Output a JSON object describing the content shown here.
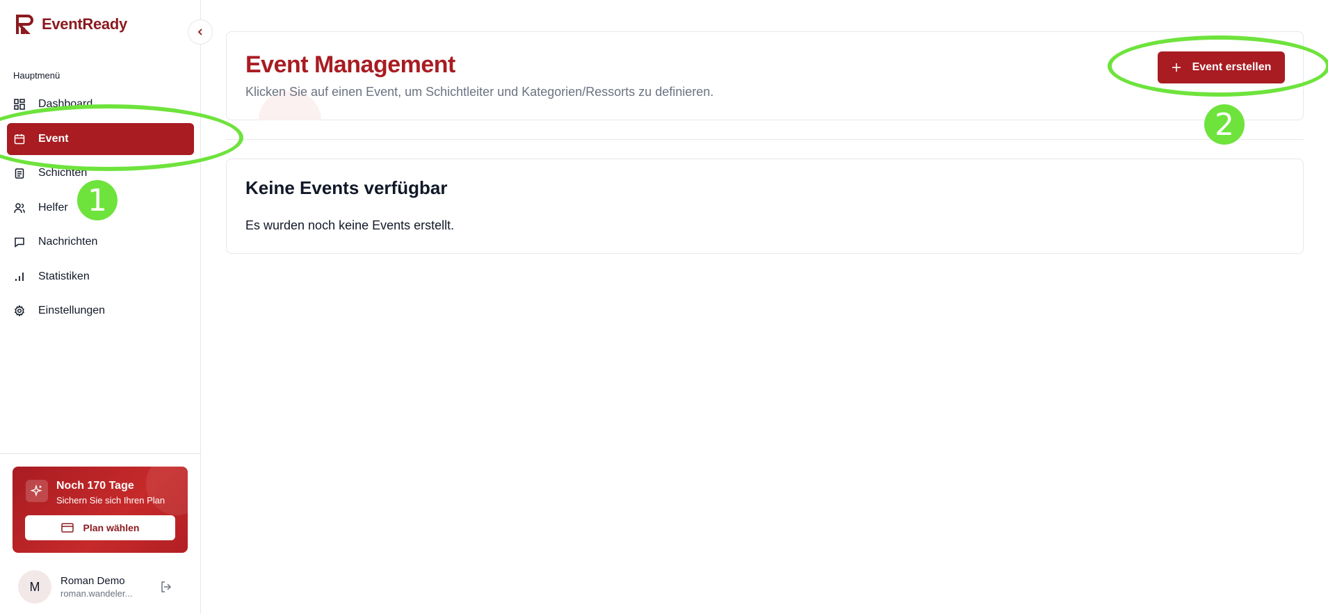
{
  "app": {
    "name": "EventReady"
  },
  "sidebar": {
    "section_label": "Hauptmenü",
    "items": [
      {
        "label": "Dashboard",
        "icon": "dashboard-icon",
        "active": false
      },
      {
        "label": "Event",
        "icon": "calendar-icon",
        "active": true
      },
      {
        "label": "Schichten",
        "icon": "clipboard-icon",
        "active": false
      },
      {
        "label": "Helfer",
        "icon": "users-icon",
        "active": false
      },
      {
        "label": "Nachrichten",
        "icon": "message-icon",
        "active": false
      },
      {
        "label": "Statistiken",
        "icon": "bar-chart-icon",
        "active": false
      },
      {
        "label": "Einstellungen",
        "icon": "gear-icon",
        "active": false
      }
    ],
    "promo": {
      "title": "Noch 170 Tage",
      "subtitle": "Sichern Sie sich Ihren Plan",
      "button_label": "Plan wählen"
    },
    "user": {
      "initial": "M",
      "name": "Roman Demo",
      "email": "roman.wandeler..."
    }
  },
  "header": {
    "title": "Event Management",
    "subtitle": "Klicken Sie auf einen Event, um Schichtleiter und Kategorien/Ressorts zu definieren.",
    "create_button_label": "Event erstellen"
  },
  "empty_state": {
    "title": "Keine Events verfügbar",
    "text": "Es wurden noch keine Events erstellt."
  },
  "annotations": [
    {
      "label": "1"
    },
    {
      "label": "2"
    }
  ],
  "colors": {
    "brand": "#a81c22",
    "annotation": "#6ee33c"
  }
}
